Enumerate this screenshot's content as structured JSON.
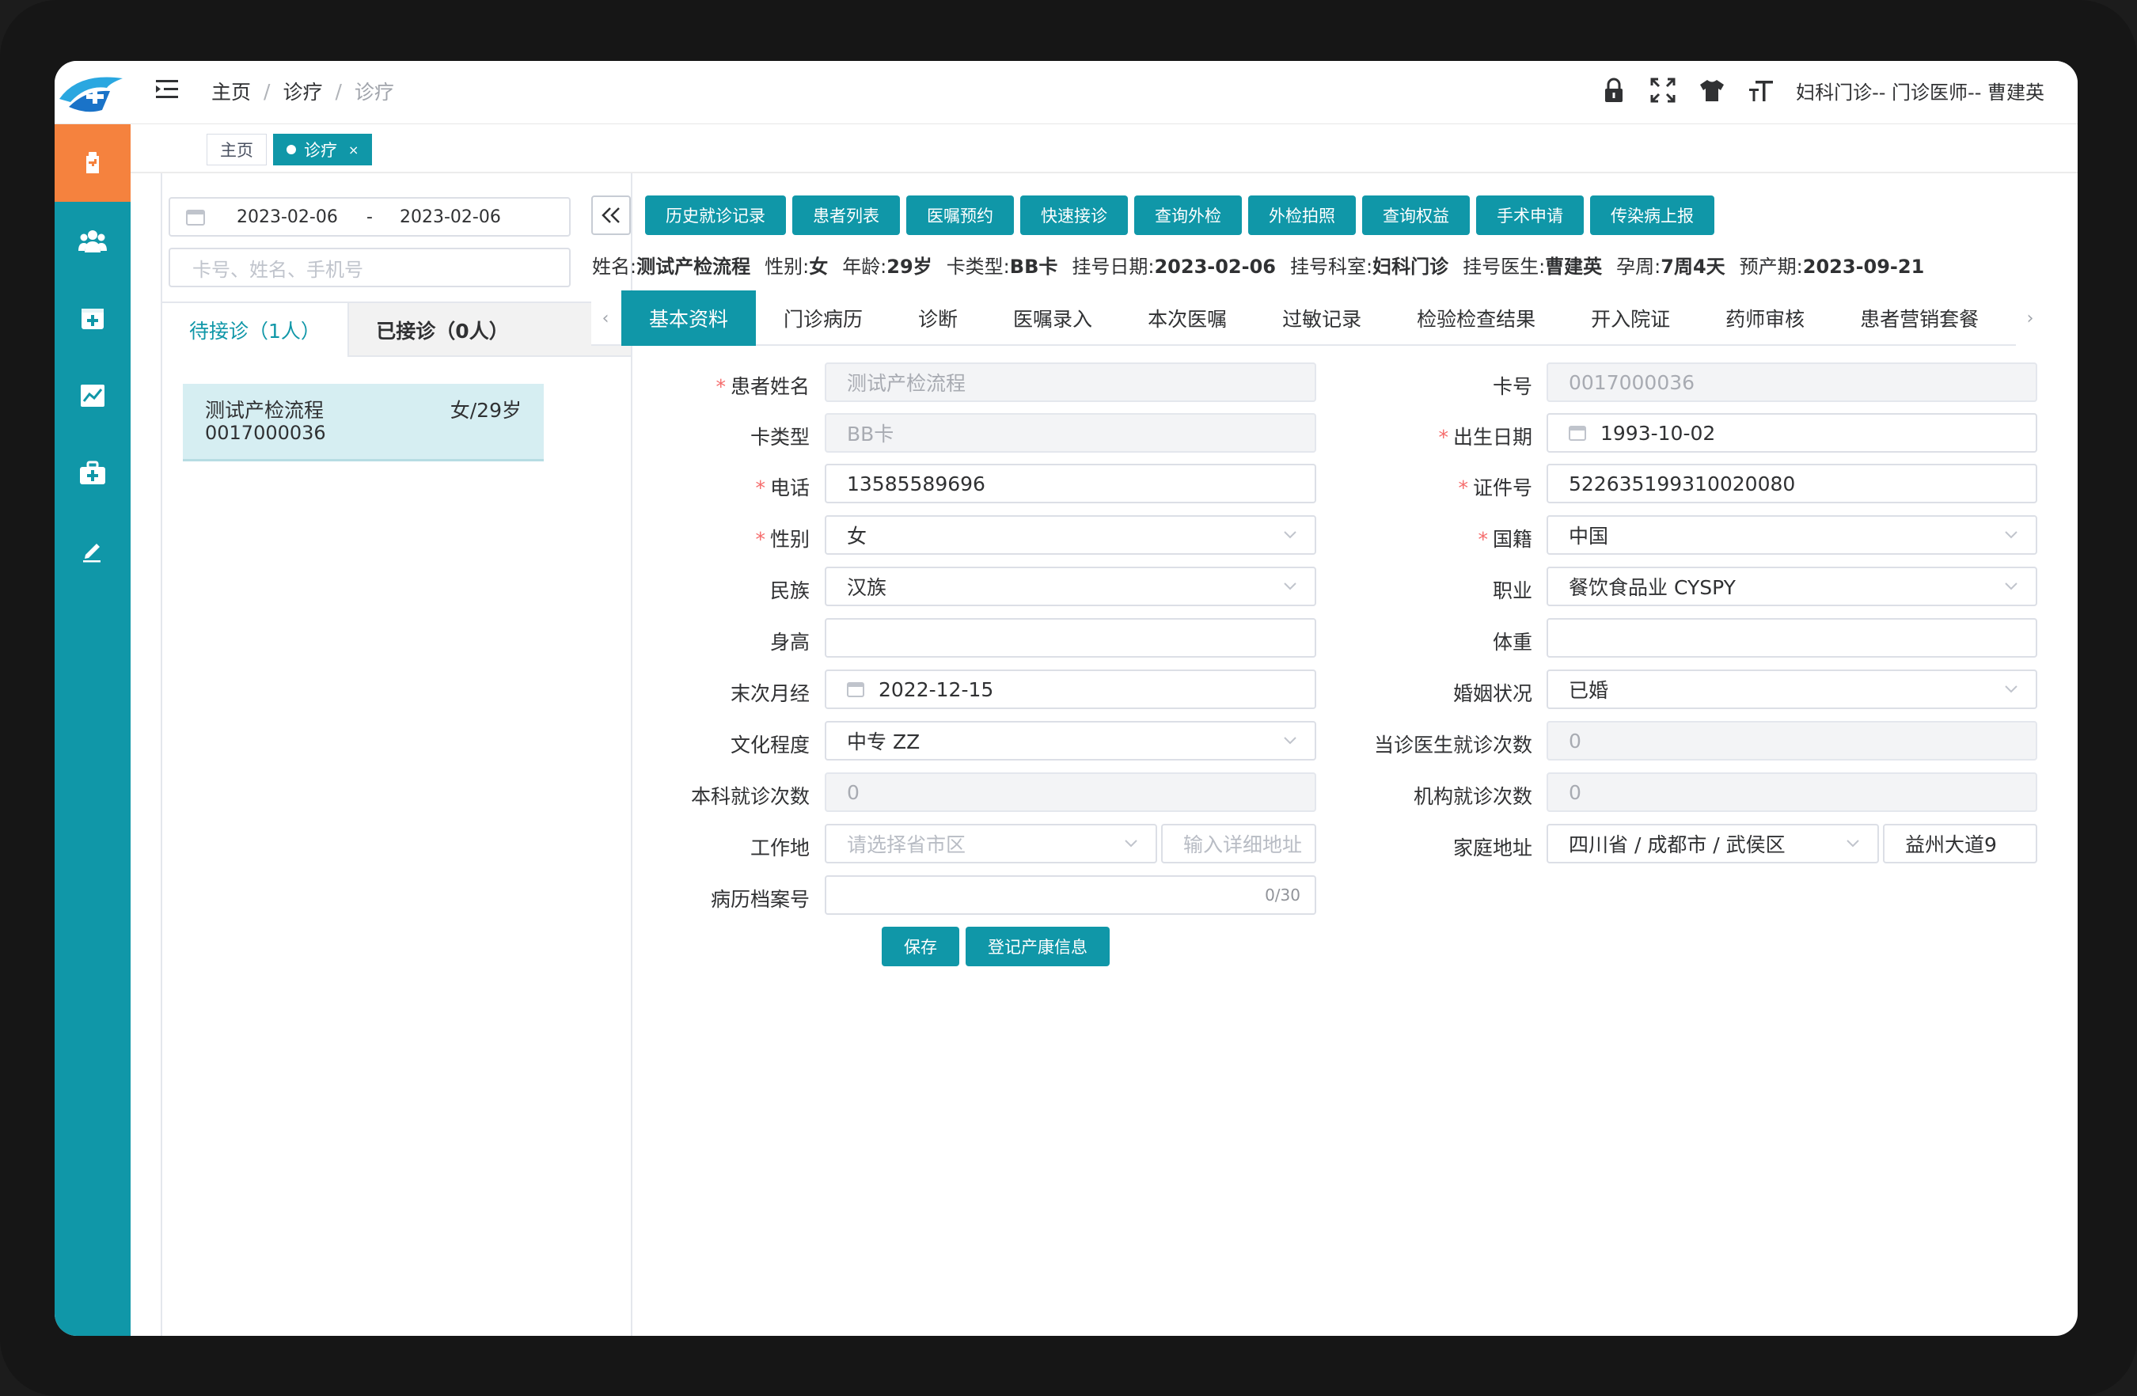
{
  "header": {
    "breadcrumbs": [
      "主页",
      "诊疗",
      "诊疗"
    ],
    "user": "妇科门诊-- 门诊医师-- 曹建英",
    "icons": [
      "lock-icon",
      "fullscreen-icon",
      "shirt-icon",
      "font-size-icon"
    ]
  },
  "sidebar": {
    "items": [
      "hospital-icon",
      "users-icon",
      "add-box-icon",
      "chart-icon",
      "medkit-icon",
      "pen-icon"
    ],
    "active_color": "#f5823e",
    "bg_color": "#1097a8"
  },
  "page_tabs": [
    {
      "label": "主页"
    },
    {
      "label": "诊疗",
      "close": "×"
    }
  ],
  "left": {
    "date_start": "2023-02-06",
    "date_sep": "-",
    "date_end": "2023-02-06",
    "search_placeholder": "卡号、姓名、手机号",
    "tab_waiting": "待接诊（1人）",
    "tab_done": "已接诊（0人）",
    "patient": {
      "name": "测试产检流程",
      "info": "女/29岁",
      "card": "0017000036"
    }
  },
  "actions": [
    "历史就诊记录",
    "患者列表",
    "医嘱预约",
    "快速接诊",
    "查询外检",
    "外检拍照",
    "查询权益",
    "手术申请",
    "传染病上报"
  ],
  "patient_line": [
    {
      "label": "姓名:",
      "value": "测试产检流程"
    },
    {
      "label": "性别:",
      "value": "女"
    },
    {
      "label": "年龄:",
      "value": "29岁"
    },
    {
      "label": "卡类型:",
      "value": "BB卡"
    },
    {
      "label": "挂号日期:",
      "value": "2023-02-06"
    },
    {
      "label": "挂号科室:",
      "value": "妇科门诊"
    },
    {
      "label": "挂号医生:",
      "value": "曹建英"
    },
    {
      "label": "孕周:",
      "value": "7周4天"
    },
    {
      "label": "预产期:",
      "value": "2023-09-21"
    }
  ],
  "subtabs": [
    "基本资料",
    "门诊病历",
    "诊断",
    "医嘱录入",
    "本次医嘱",
    "过敏记录",
    "检验检查结果",
    "开入院证",
    "药师审核",
    "患者营销套餐"
  ],
  "subtab_arrows": {
    "left": "‹",
    "right": "›"
  },
  "form": {
    "name": {
      "label": "患者姓名",
      "value": "测试产检流程"
    },
    "card_no": {
      "label": "卡号",
      "value": "0017000036"
    },
    "card_type": {
      "label": "卡类型",
      "value": "BB卡"
    },
    "birth": {
      "label": "出生日期",
      "value": "1993-10-02"
    },
    "phone": {
      "label": "电话",
      "value": "13585589696"
    },
    "id_no": {
      "label": "证件号",
      "value": "522635199310020080"
    },
    "gender": {
      "label": "性别",
      "value": "女"
    },
    "nationality": {
      "label": "国籍",
      "value": "中国"
    },
    "ethnic": {
      "label": "民族",
      "value": "汉族"
    },
    "job": {
      "label": "职业",
      "value": "餐饮食品业 CYSPY"
    },
    "height": {
      "label": "身高",
      "value": ""
    },
    "weight": {
      "label": "体重",
      "value": ""
    },
    "lmp": {
      "label": "末次月经",
      "value": "2022-12-15"
    },
    "marriage": {
      "label": "婚姻状况",
      "value": "已婚"
    },
    "education": {
      "label": "文化程度",
      "value": "中专 ZZ"
    },
    "doctor_visits": {
      "label": "当诊医生就诊次数",
      "value": "0"
    },
    "dept_visits": {
      "label": "本科就诊次数",
      "value": "0"
    },
    "org_visits": {
      "label": "机构就诊次数",
      "value": "0"
    },
    "work": {
      "label": "工作地",
      "region_placeholder": "请选择省市区",
      "detail_placeholder": "输入详细地址"
    },
    "home": {
      "label": "家庭地址",
      "region": "四川省 / 成都市 / 武侯区",
      "detail": "益州大道9"
    },
    "record_no": {
      "label": "病历档案号",
      "value": "",
      "count": "0/30"
    },
    "required_mark": "*"
  },
  "buttons": {
    "save": "保存",
    "register": "登记产康信息"
  },
  "colors": {
    "primary": "#1097a8",
    "accent": "#f5823e",
    "required": "#f56c6c"
  }
}
